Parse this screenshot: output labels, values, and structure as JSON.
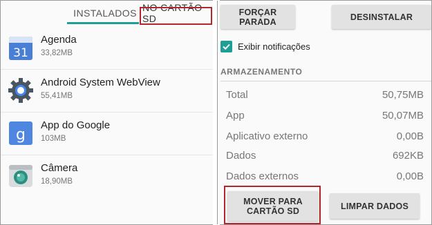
{
  "tabs": {
    "installed": "INSTALADOS",
    "sd": "NO CARTÃO SD"
  },
  "apps": [
    {
      "name": "Agenda",
      "size": "33,82MB",
      "icon": "calendar-icon",
      "icon_text": "31"
    },
    {
      "name": "Android System WebView",
      "size": "55,41MB",
      "icon": "webview-gear-icon"
    },
    {
      "name": "App do Google",
      "size": "103MB",
      "icon": "google-icon",
      "icon_text": "g"
    },
    {
      "name": "Câmera",
      "size": "18,90MB",
      "icon": "camera-icon"
    }
  ],
  "buttons": {
    "force_stop": "FORÇAR PARADA",
    "uninstall": "DESINSTALAR",
    "move_to_sd": "MOVER PARA CARTÃO SD",
    "clear_data": "LIMPAR DADOS"
  },
  "notifications": {
    "label": "Exibir notificações",
    "checked": true
  },
  "storage": {
    "title": "ARMAZENAMENTO",
    "rows": [
      {
        "label": "Total",
        "value": "50,75MB"
      },
      {
        "label": "App",
        "value": "50,07MB"
      },
      {
        "label": "Aplicativo externo",
        "value": "0,00B"
      },
      {
        "label": "Dados",
        "value": "692KB"
      },
      {
        "label": "Dados externos",
        "value": "0,00B"
      }
    ]
  },
  "colors": {
    "accent": "#1e9f96",
    "highlight": "#b3262b"
  }
}
